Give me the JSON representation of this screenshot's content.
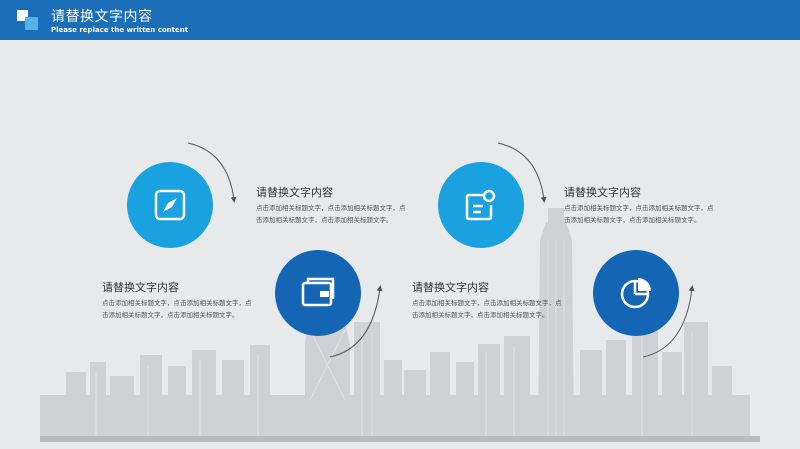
{
  "header": {
    "title": "请替换文字内容",
    "subtitle": "Please replace the written content"
  },
  "colors": {
    "header_bg": "#1b6fb8",
    "light_blue": "#1aa1e0",
    "dark_blue": "#1565b5",
    "background": "#e8e9eb",
    "skyline": "#cfd1d4"
  },
  "items": [
    {
      "icon": "compass-icon",
      "heading": "请替换文字内容",
      "body": "点击添加相关标题文字，点击添加相关标题文字，点击添加相关标题文字，点击添加相关标题文字。"
    },
    {
      "icon": "wallet-icon",
      "heading": "请替换文字内容",
      "body": "点击添加相关标题文字，点击添加相关标题文字，点击添加相关标题文字，点击添加相关标题文字。"
    },
    {
      "icon": "message-icon",
      "heading": "请替换文字内容",
      "body": "点击添加相关标题文字，点击添加相关标题文字，点击添加相关标题文字，点击添加相关标题文字。"
    },
    {
      "icon": "pie-chart-icon",
      "heading": "请替换文字内容",
      "body": "点击添加相关标题文字，点击添加相关标题文字，点击添加相关标题文字，点击添加相关标题文字。"
    }
  ]
}
